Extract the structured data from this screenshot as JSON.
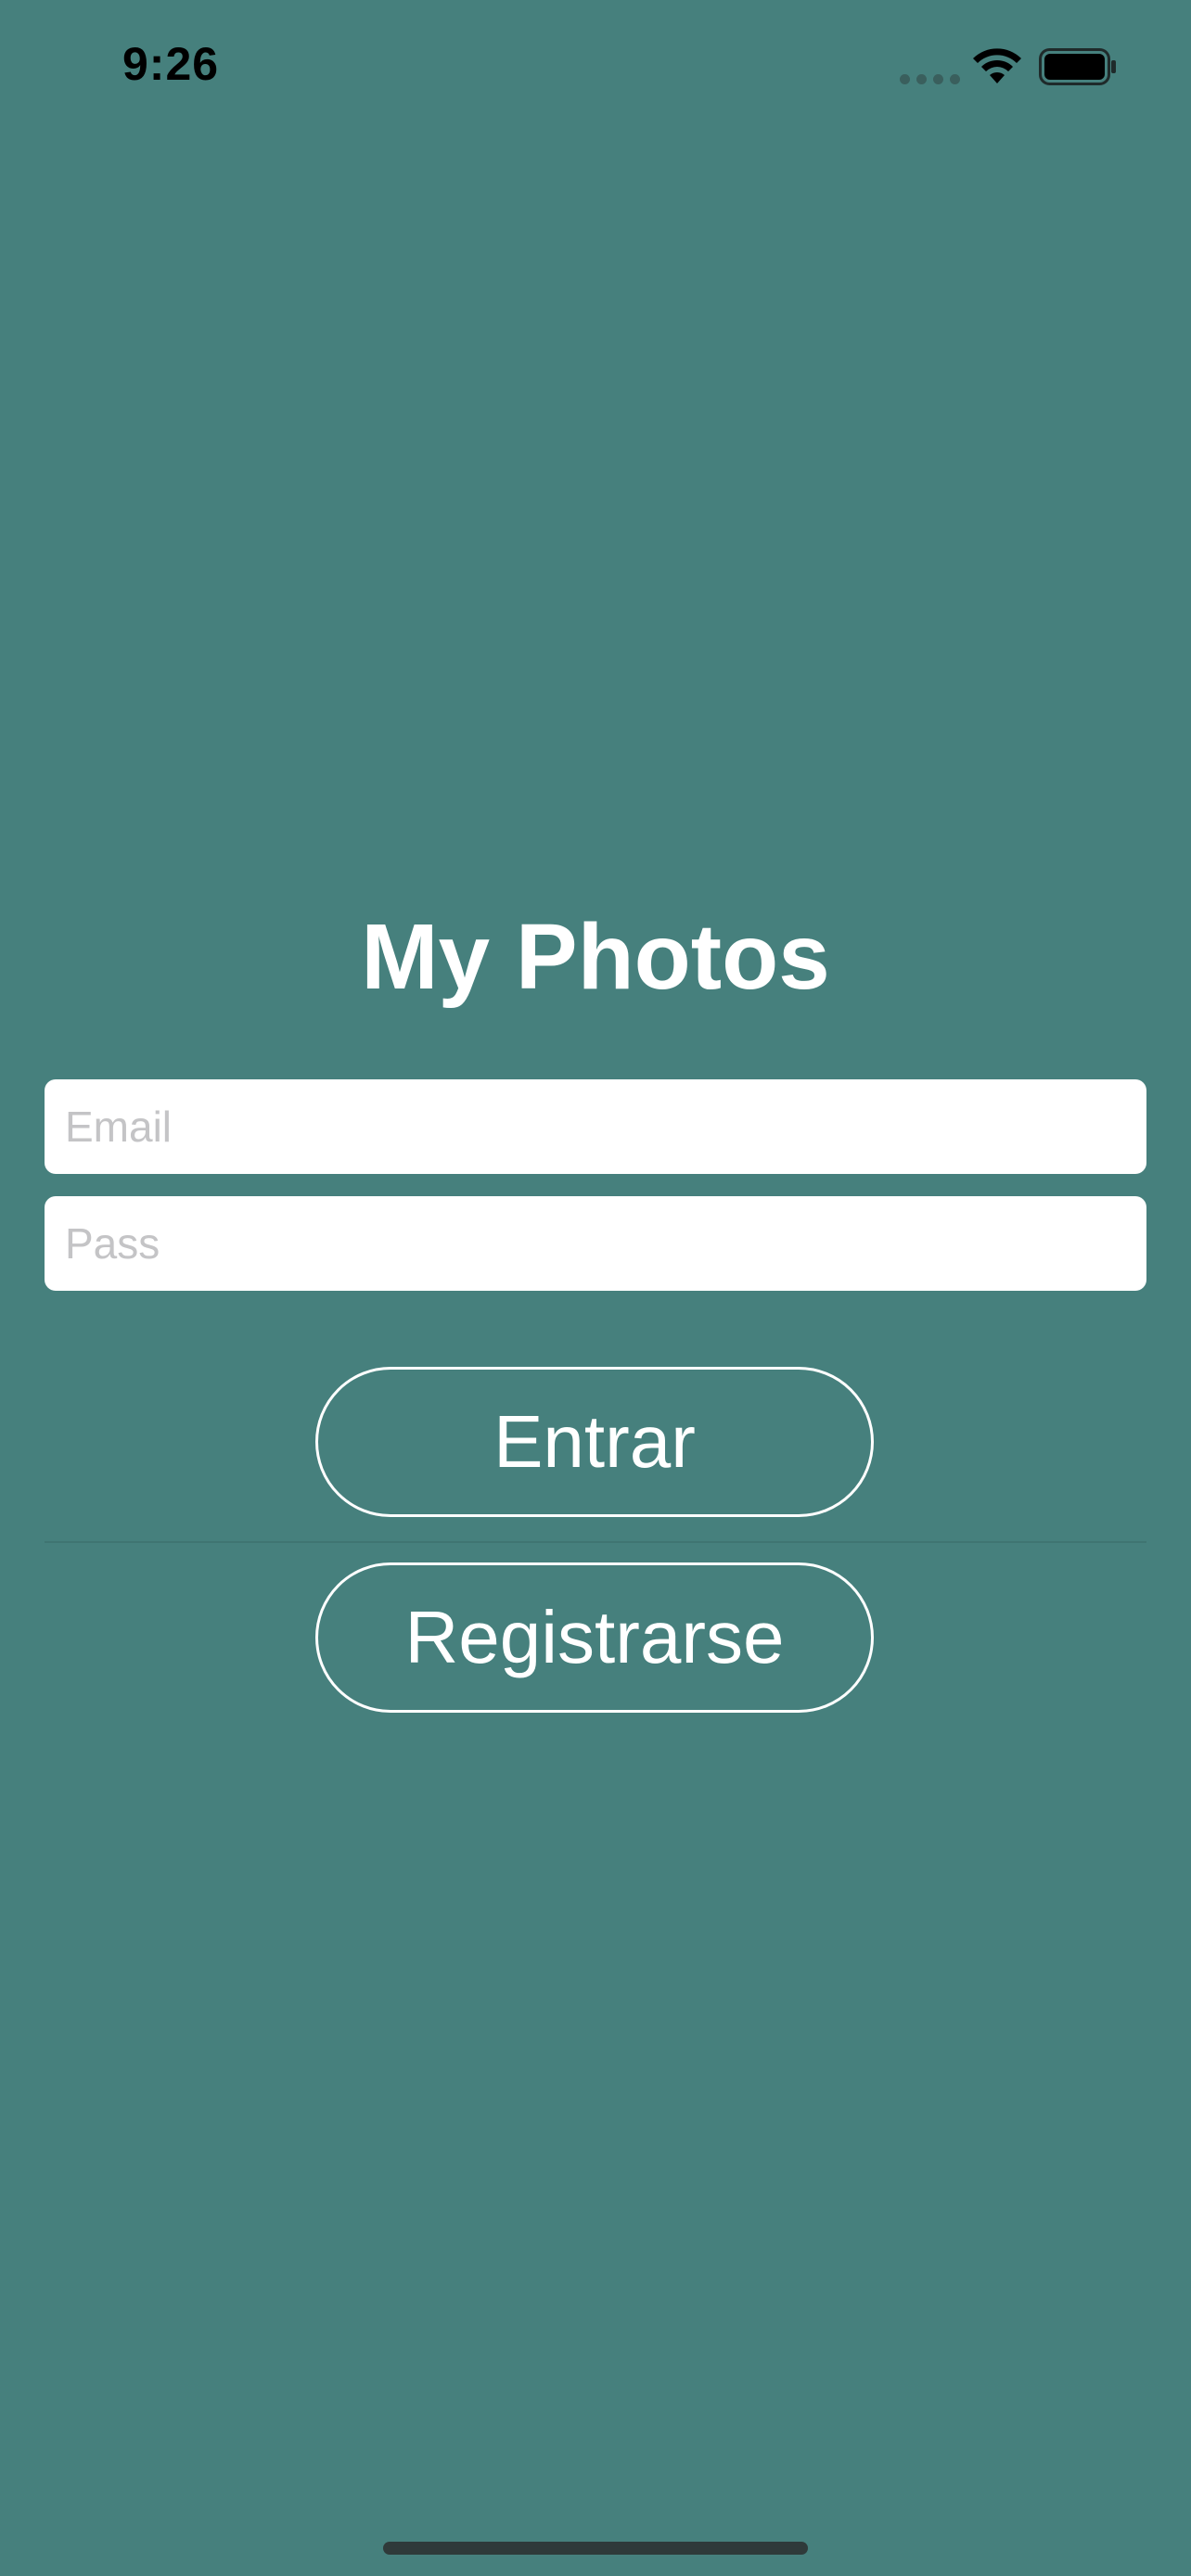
{
  "status_bar": {
    "time": "9:26",
    "icons": [
      "signal-dots-icon",
      "wifi-icon",
      "battery-icon"
    ]
  },
  "app": {
    "title": "My Photos",
    "background_color": "#46807D"
  },
  "form": {
    "email_placeholder": "Email",
    "email_value": "",
    "pass_placeholder": "Pass",
    "pass_value": "",
    "login_label": "Entrar",
    "register_label": "Registrarse"
  }
}
